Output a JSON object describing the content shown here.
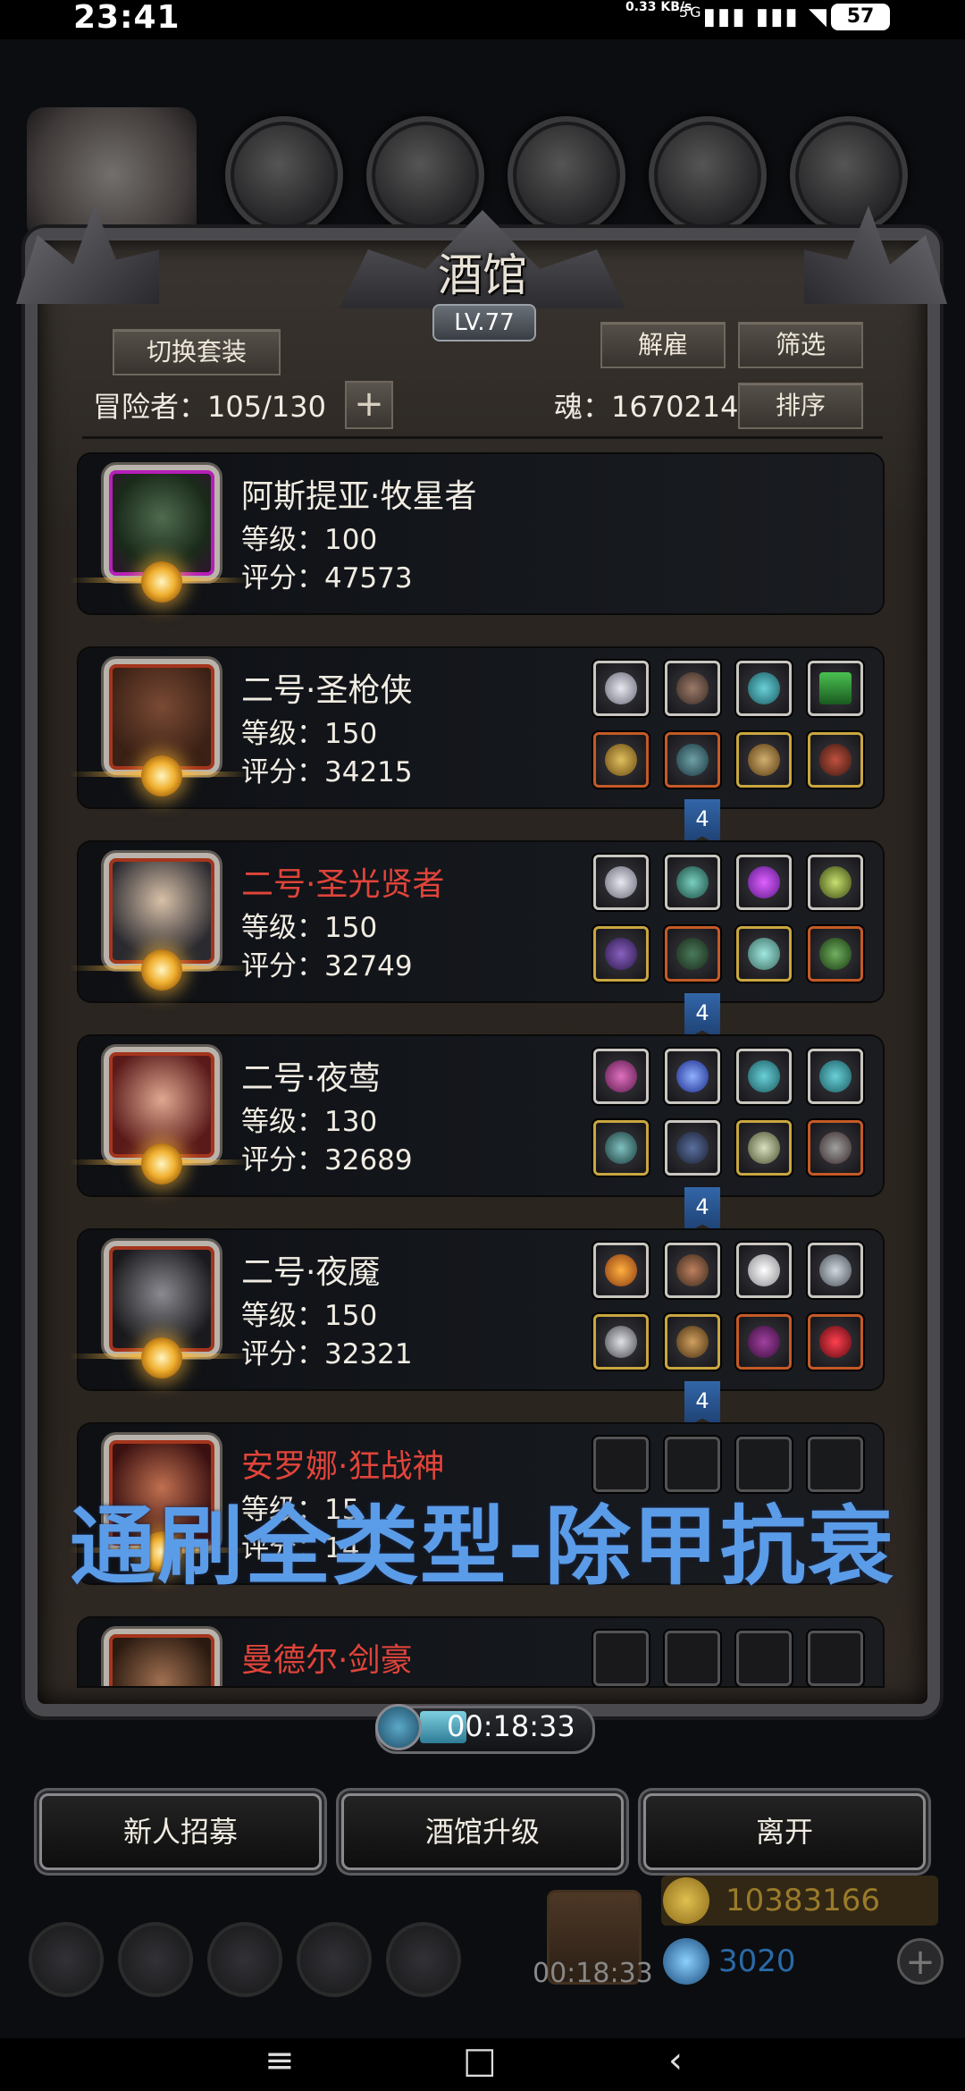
{
  "status_bar": {
    "time": "23:41",
    "net_speed": "0.33 KB/s",
    "network": "5G",
    "battery": "57"
  },
  "tavern": {
    "title": "酒馆",
    "level": "LV.77",
    "switch_outfit": "切换套装",
    "fire": "解雇",
    "filter": "筛选",
    "sort": "排序",
    "adventurers_label": "冒险者：105/130",
    "soul_label": "魂：1670214"
  },
  "heroes": [
    {
      "name": "阿斯提亚·牧星者",
      "level": "等级：100",
      "score": "评分：47573",
      "name_color": "white",
      "frame": "purple"
    },
    {
      "name": "二号·圣枪侠",
      "level": "等级：150",
      "score": "评分：34215",
      "name_color": "white",
      "frame": "red",
      "set_count": "4"
    },
    {
      "name": "二号·圣光贤者",
      "level": "等级：150",
      "score": "评分：32749",
      "name_color": "red",
      "frame": "red",
      "set_count": "4"
    },
    {
      "name": "二号·夜莺",
      "level": "等级：130",
      "score": "评分：32689",
      "name_color": "white",
      "frame": "red",
      "set_count": "4"
    },
    {
      "name": "二号·夜魇",
      "level": "等级：150",
      "score": "评分：32321",
      "name_color": "white",
      "frame": "red",
      "set_count": "4"
    },
    {
      "name": "安罗娜·狂战神",
      "level": "等级：15",
      "score": "评分：14",
      "name_color": "red",
      "frame": "red"
    },
    {
      "name": "曼德尔·剑豪",
      "level": "",
      "score": "",
      "name_color": "red",
      "frame": "red"
    }
  ],
  "overlay_text": "通刷全类型-除甲抗衰",
  "timer": "00:18:33",
  "bottom_buttons": {
    "recruit": "新人招募",
    "upgrade": "酒馆升级",
    "leave": "离开"
  },
  "hud": {
    "gift_timer": "00:18:33",
    "gold": "10383166",
    "gems": "3020",
    "add_symbol": "+"
  },
  "colors": {
    "accent_blue": "#5b9ce8",
    "red_name": "#e0443a",
    "gold": "#f3b640"
  }
}
